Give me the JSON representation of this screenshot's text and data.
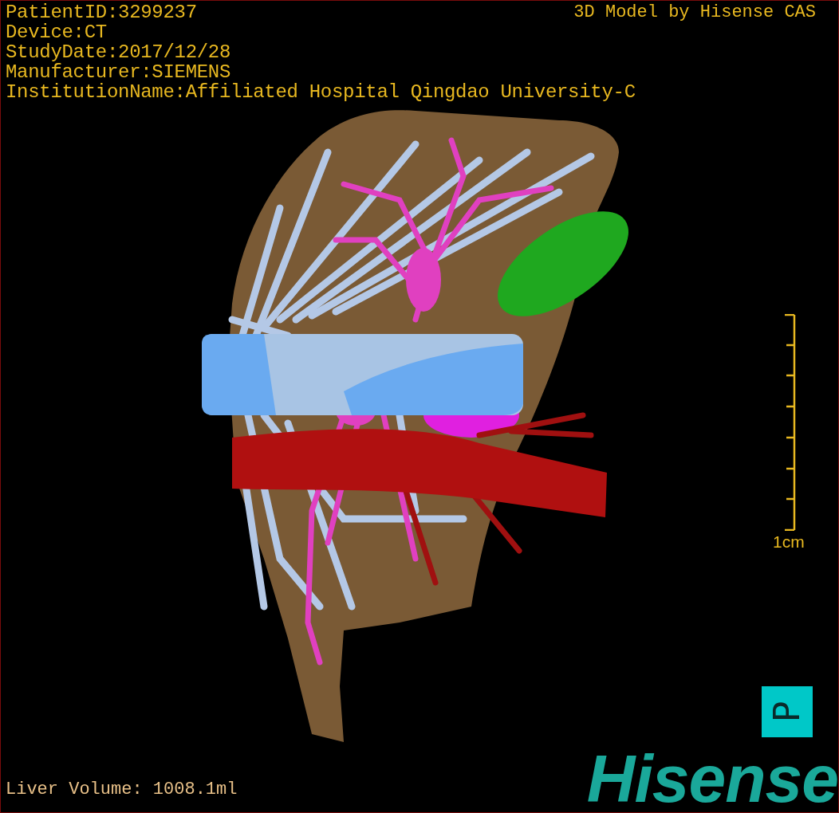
{
  "patient_info": [
    "PatientID:3299237",
    "Device:CT",
    "StudyDate:2017/12/28",
    "Manufacturer:SIEMENS",
    "InstitutionName:Affiliated Hospital Qingdao University-C"
  ],
  "model_caption": "3D Model by Hisense CAS",
  "scale_bar": {
    "label": "1cm"
  },
  "orientation_marker": {
    "label": "P"
  },
  "logo": "Hisense",
  "liver_volume": "Liver Volume: 1008.1ml"
}
